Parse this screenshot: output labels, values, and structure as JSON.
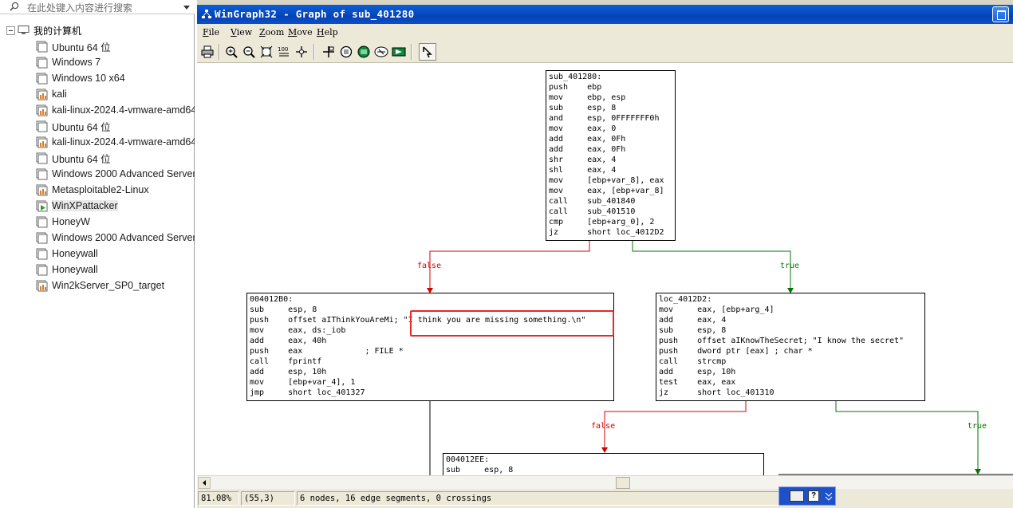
{
  "vm_panel": {
    "search_placeholder": "在此处键入内容进行搜索",
    "root_label": "我的计算机",
    "vms": [
      {
        "label": "Ubuntu 64 位",
        "icon": "vm-off-icon"
      },
      {
        "label": "Windows 7",
        "icon": "vm-off-icon"
      },
      {
        "label": "Windows 10 x64",
        "icon": "vm-off-icon"
      },
      {
        "label": "kali",
        "icon": "vm-shared-icon"
      },
      {
        "label": "kali-linux-2024.4-vmware-amd64",
        "icon": "vm-shared-icon"
      },
      {
        "label": "Ubuntu 64 位",
        "icon": "vm-off-icon"
      },
      {
        "label": "kali-linux-2024.4-vmware-amd64",
        "icon": "vm-shared-icon"
      },
      {
        "label": "Ubuntu 64 位",
        "icon": "vm-off-icon"
      },
      {
        "label": "Windows 2000 Advanced Server",
        "icon": "vm-off-icon"
      },
      {
        "label": "Metasploitable2-Linux",
        "icon": "vm-shared-icon"
      },
      {
        "label": "WinXPattacker",
        "icon": "vm-running-icon",
        "selected": true
      },
      {
        "label": "HoneyW",
        "icon": "vm-off-icon"
      },
      {
        "label": "Windows 2000 Advanced Server",
        "icon": "vm-off-icon"
      },
      {
        "label": "Honeywall",
        "icon": "vm-off-icon"
      },
      {
        "label": "Honeywall",
        "icon": "vm-off-icon"
      },
      {
        "label": "Win2kServer_SP0_target",
        "icon": "vm-shared-icon"
      }
    ]
  },
  "window": {
    "title": "WinGraph32 - Graph of sub_401280"
  },
  "menu": [
    "File",
    "View",
    "Zoom",
    "Move",
    "Help"
  ],
  "toolbar": [
    "print-icon",
    "zoom-in-icon",
    "zoom-out-icon",
    "fit-window-icon",
    "zoom-100-icon",
    "center-icon",
    "layout-icon",
    "overview-icon",
    "color-icon",
    "options-icon",
    "run-icon",
    "cursor-icon"
  ],
  "toolbar_zoom100_text": "100",
  "graph": {
    "nodes": [
      {
        "id": "node-sub_401280",
        "lines": [
          "sub_401280:",
          "push    ebp",
          "mov     ebp, esp",
          "sub     esp, 8",
          "and     esp, 0FFFFFFF0h",
          "mov     eax, 0",
          "add     eax, 0Fh",
          "add     eax, 0Fh",
          "shr     eax, 4",
          "shl     eax, 4",
          "mov     [ebp+var_8], eax",
          "mov     eax, [ebp+var_8]",
          "call    sub_401840",
          "call    sub_401510",
          "cmp     [ebp+arg_0], 2",
          "jz      short loc_4012D2"
        ]
      },
      {
        "id": "node-004012B0",
        "lines": [
          "004012B0:",
          "sub     esp, 8",
          "push    offset aIThinkYouAreMi; \"I think you are missing something.\\n\"",
          "mov     eax, ds:_iob",
          "add     eax, 40h",
          "push    eax             ; FILE *",
          "call    fprintf",
          "add     esp, 10h",
          "mov     [ebp+var_4], 1",
          "jmp     short loc_401327"
        ]
      },
      {
        "id": "node-loc_4012D2",
        "lines": [
          "loc_4012D2:",
          "mov     eax, [ebp+arg_4]",
          "add     eax, 4",
          "sub     esp, 8",
          "push    offset aIKnowTheSecret; \"I know the secret\"",
          "push    dword ptr [eax] ; char *",
          "call    strcmp",
          "add     esp, 10h",
          "test    eax, eax",
          "jz      short loc_401310"
        ]
      },
      {
        "id": "node-004012EE",
        "lines": [
          "004012EE:",
          "sub     esp, 8"
        ]
      }
    ],
    "edge_labels": {
      "false": "false",
      "true": "true"
    },
    "colors": {
      "false_edge": "#d40000",
      "true_edge": "#007800",
      "highlight": "#e8282a"
    }
  },
  "status": {
    "zoom": "81.08%",
    "coords": "(55,3)",
    "info": "6 nodes, 16 edge segments, 0 crossings"
  },
  "language_bar": {
    "help_label": "?"
  }
}
